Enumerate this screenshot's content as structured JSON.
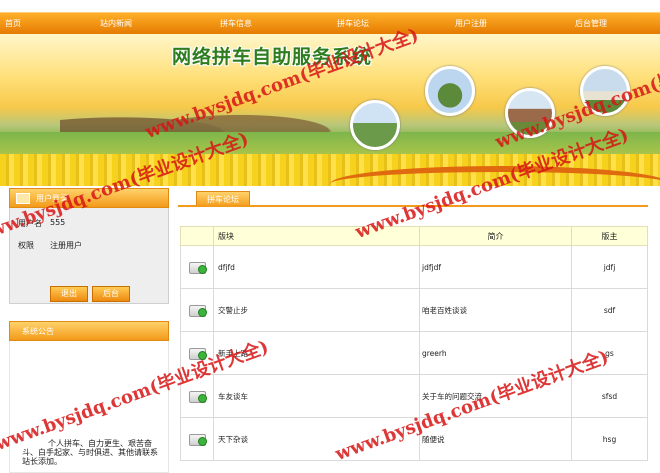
{
  "nav": {
    "items": [
      "首页",
      "站内新闻",
      "拼车信息",
      "拼车论坛",
      "用户注册",
      "后台管理"
    ]
  },
  "banner": {
    "title": "网络拼车自助服务系统"
  },
  "login": {
    "title": "用户登录",
    "username_label": "用户名",
    "username_value": "555",
    "role_label": "权限",
    "role_value": "注册用户",
    "logout_button": "退出",
    "admin_button": "后台"
  },
  "notice": {
    "title": "系统公告",
    "text": "个人拼车、自力更生、艰苦奋斗、白手起家、与时俱进、其他请联系站长添加。"
  },
  "forum": {
    "tab": "拼车论坛",
    "headers": {
      "board": "版块",
      "intro": "简介",
      "moderator": "版主"
    },
    "rows": [
      {
        "board": "dfjfd",
        "intro": "jdfjdf",
        "moderator": "jdfj"
      },
      {
        "board": "交警止步",
        "intro": "咱老百姓谈谈",
        "moderator": "sdf"
      },
      {
        "board": "新手上路",
        "intro": "greerh",
        "moderator": "gs"
      },
      {
        "board": "车友谈车",
        "intro": "关于车的问题交流",
        "moderator": "sfsd"
      },
      {
        "board": "天下杂谈",
        "intro": "随便说",
        "moderator": "hsg"
      }
    ]
  },
  "watermarks": [
    "www.bysjdq.com(毕业设计大全)",
    "www.bysjdq.com(毕业设计大全)",
    "www.bysjdq.com(毕业设计大全)",
    "www.bysjdq.com(毕业设计大全)",
    "www.bysjdq.com(毕业设计大全)",
    "www.bysjdq.com(毕业设计大全)"
  ],
  "colors": {
    "accent": "#f39a1a",
    "watermark": "#d71414",
    "title_green": "#2d7d1f"
  }
}
